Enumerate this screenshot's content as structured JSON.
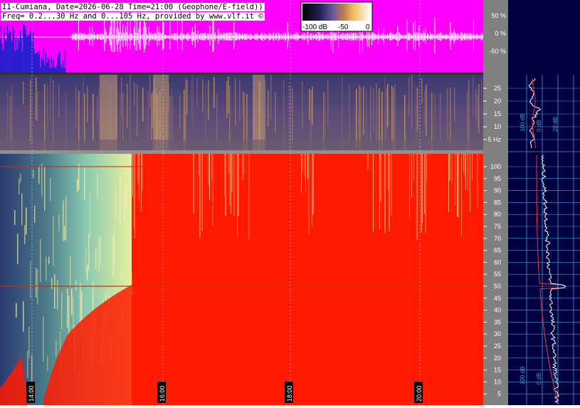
{
  "header": {
    "line1": "I1-Cumiana, Date=2026-06-28 Time=21:00 (Geophone/E-field))",
    "line2": "Freq= 0.2...30 Hz and 0...105 Hz, provided by www.vlf.it ©"
  },
  "colorbar": {
    "label_low": "-100 dB",
    "label_mid": "-50",
    "label_high": "0"
  },
  "waveform_axis": {
    "ticks": [
      "50 %",
      "0 %",
      "-50 %"
    ]
  },
  "top_spectro_axis": {
    "ticks": [
      "25",
      "20",
      "15",
      "10",
      "5 Hz"
    ]
  },
  "bottom_spectro_axis": {
    "ticks": [
      "100",
      "95",
      "90",
      "85",
      "80",
      "75",
      "70",
      "65",
      "60",
      "55",
      "50",
      "45",
      "40",
      "35",
      "30",
      "25",
      "20",
      "15",
      "10",
      "5"
    ]
  },
  "profile_labels": [
    "100 dB",
    "0 dB",
    "20 dB"
  ],
  "time_labels": [
    "14:00",
    "16:00",
    "18:00",
    "20:00"
  ],
  "colors": {
    "magenta": "#ff00ff",
    "red": "#ff1a00",
    "navy": "#000040",
    "grey": "#808080",
    "cyan_grid": "#3aa0d8"
  }
}
